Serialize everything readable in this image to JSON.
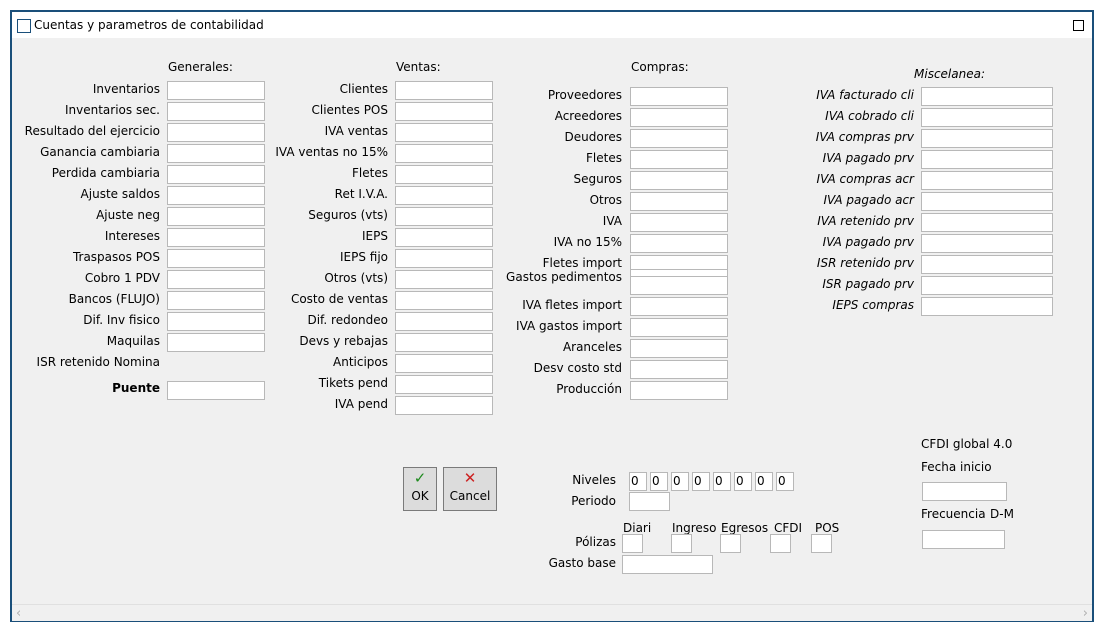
{
  "window": {
    "title": "Cuentas y parametros de contabilidad"
  },
  "generales": {
    "header": "Generales:",
    "items": [
      "Inventarios",
      "Inventarios sec.",
      "Resultado del ejercicio",
      "Ganancia cambiaria",
      "Perdida cambiaria",
      "Ajuste saldos",
      "Ajuste neg",
      "Intereses",
      "Traspasos POS",
      "Cobro 1 PDV",
      "Bancos (FLUJO)",
      "Dif. Inv fisico",
      "Maquilas",
      "ISR retenido Nomina"
    ],
    "puente": "Puente"
  },
  "ventas": {
    "header": "Ventas:",
    "items": [
      "Clientes",
      "Clientes POS",
      "IVA ventas",
      "IVA ventas no 15%",
      "Fletes",
      "Ret I.V.A.",
      "Seguros (vts)",
      "IEPS",
      "IEPS fijo",
      "Otros (vts)",
      "Costo de ventas",
      "Dif. redondeo",
      "Devs y rebajas",
      "Anticipos",
      "Tikets pend",
      "IVA pend"
    ]
  },
  "compras": {
    "header": "Compras:",
    "items": [
      "Proveedores",
      "Acreedores",
      "Deudores",
      "Fletes",
      "Seguros",
      "Otros",
      "IVA",
      "IVA  no 15%",
      "Fletes import",
      "Gastos pedimentos",
      "IVA fletes import",
      "IVA gastos import",
      "Aranceles",
      "Desv costo std",
      "Producción"
    ]
  },
  "miscelanea": {
    "header": "Miscelanea:",
    "items": [
      "IVA facturado cli",
      "IVA cobrado cli",
      "IVA compras prv",
      "IVA pagado prv",
      "IVA compras acr",
      "IVA pagado acr",
      "IVA retenido prv",
      "IVA pagado prv",
      "ISR retenido prv",
      "ISR pagado prv",
      "IEPS compras"
    ]
  },
  "buttons": {
    "ok_label": "OK",
    "cancel_label": "Cancel"
  },
  "niveles": {
    "label": "Niveles",
    "values": [
      "0",
      "0",
      "0",
      "0",
      "0",
      "0",
      "0",
      "0"
    ]
  },
  "periodo": {
    "label": "Periodo",
    "value": ""
  },
  "polizas": {
    "label": "Pólizas",
    "columns": [
      "Diari",
      "Ingreso",
      "Egresos",
      "CFDI",
      "POS"
    ]
  },
  "gasto_base": {
    "label": "Gasto base",
    "value": ""
  },
  "cfdi": {
    "title": "CFDI global 4.0",
    "fecha_label": "Fecha inicio",
    "frecuencia_label": "Frecuencia",
    "frecuencia_hint": "D-M"
  },
  "colors": {
    "border": "#1a4f7a",
    "ok_icon": "#1e8a1e",
    "cancel_icon": "#cc2222"
  },
  "icons": {
    "ok": "check-icon",
    "cancel": "cross-icon"
  }
}
